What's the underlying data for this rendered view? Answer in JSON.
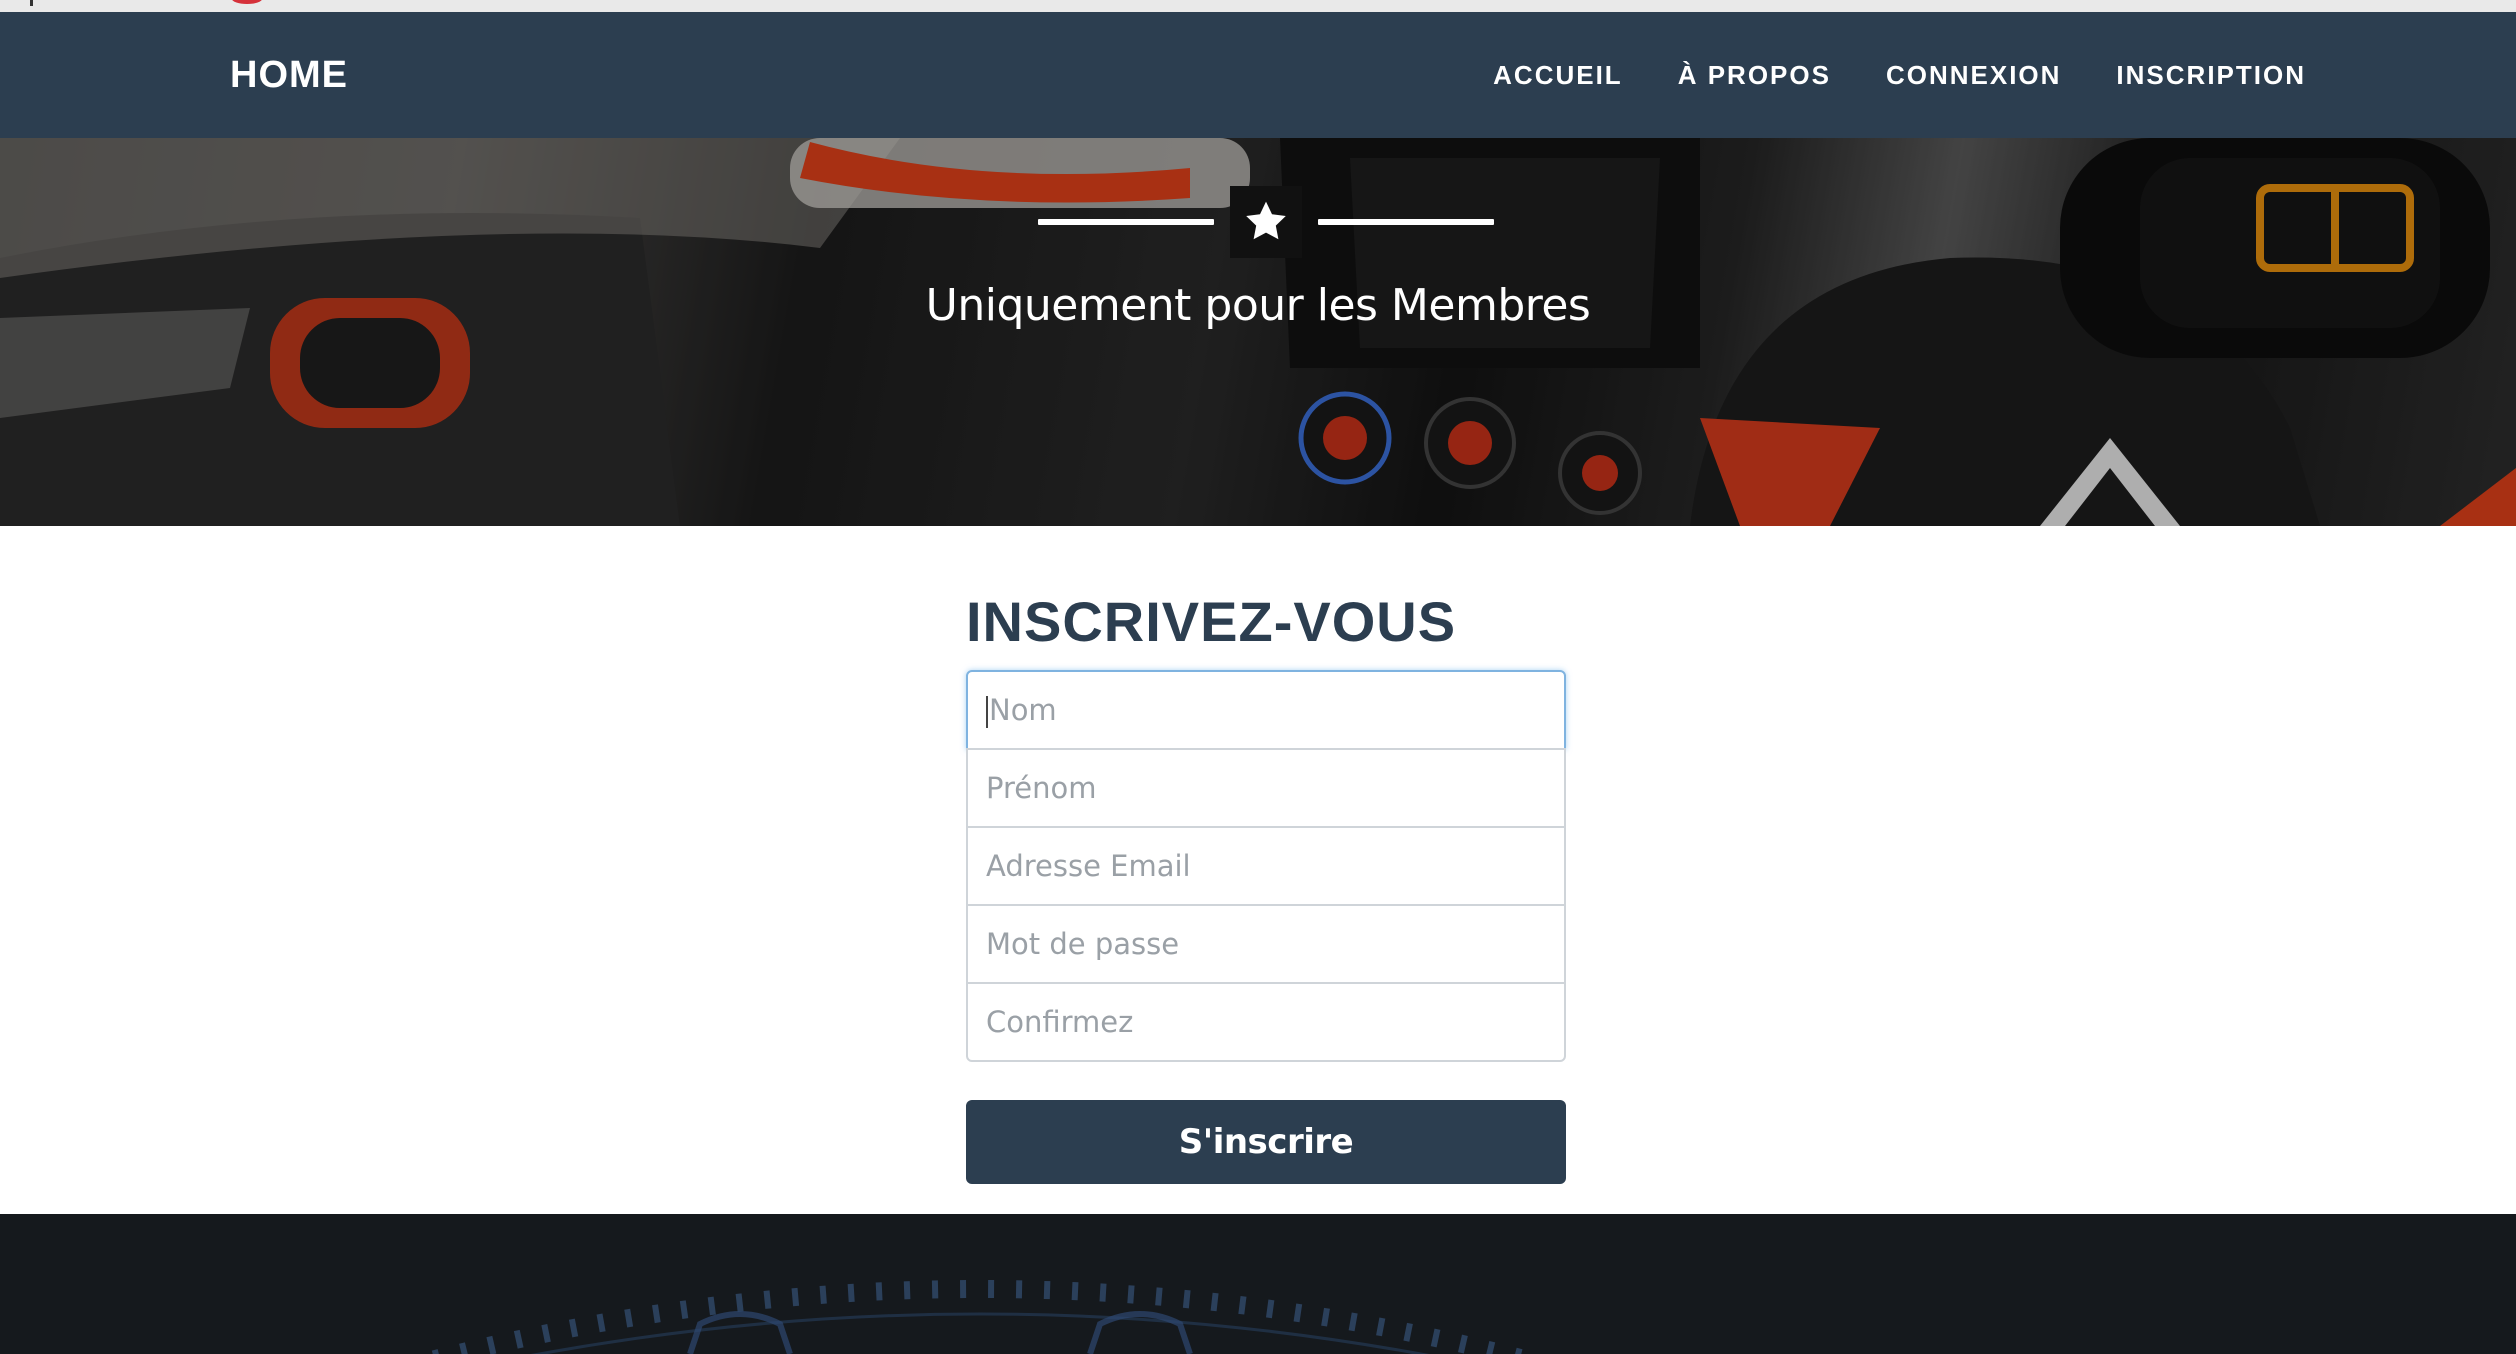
{
  "navbar": {
    "brand": "HOME",
    "links": [
      "ACCUEIL",
      "À PROPOS",
      "CONNEXION",
      "INSCRIPTION"
    ]
  },
  "header": {
    "tagline": "Uniquement pour les Membres",
    "icon": "star-icon"
  },
  "signup": {
    "title": "INSCRIVEZ-VOUS",
    "fields": [
      {
        "placeholder": "Nom",
        "value": ""
      },
      {
        "placeholder": "Prénom",
        "value": ""
      },
      {
        "placeholder": "Adresse Email",
        "value": ""
      },
      {
        "placeholder": "Mot de passe",
        "value": ""
      },
      {
        "placeholder": "Confirmez",
        "value": ""
      }
    ],
    "submit_label": "S'inscrire"
  },
  "colors": {
    "navbar": "#2c3e50",
    "button": "#2c3e50",
    "accent_red": "#d5313a"
  }
}
